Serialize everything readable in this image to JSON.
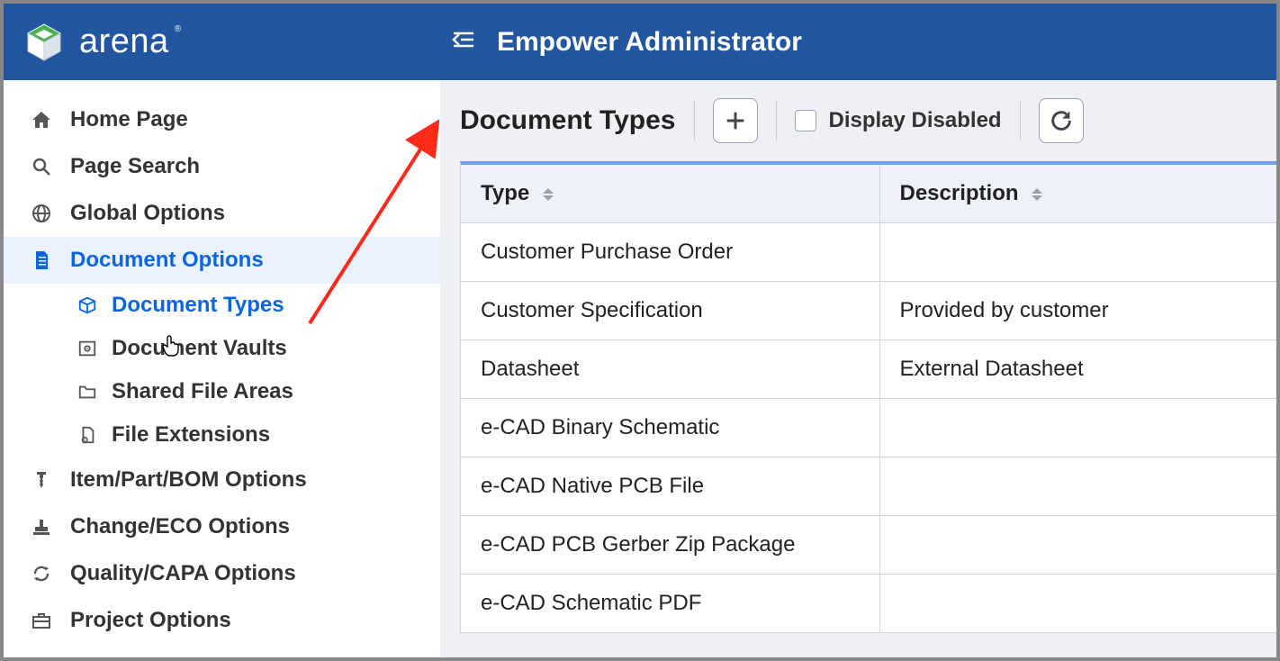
{
  "brand": {
    "name": "arena"
  },
  "header": {
    "app_title": "Empower Administrator"
  },
  "sidebar": {
    "items": [
      {
        "label": "Home Page"
      },
      {
        "label": "Page Search"
      },
      {
        "label": "Global Options"
      },
      {
        "label": "Document Options"
      },
      {
        "label": "Item/Part/BOM Options"
      },
      {
        "label": "Change/ECO Options"
      },
      {
        "label": "Quality/CAPA Options"
      },
      {
        "label": "Project Options"
      }
    ],
    "document_subitems": [
      {
        "label": "Document Types"
      },
      {
        "label": "Document Vaults"
      },
      {
        "label": "Shared File Areas"
      },
      {
        "label": "File Extensions"
      }
    ]
  },
  "main": {
    "title": "Document Types",
    "display_disabled_label": "Display Disabled",
    "columns": {
      "type": "Type",
      "description": "Description"
    },
    "rows": [
      {
        "type": "Customer Purchase Order",
        "description": ""
      },
      {
        "type": "Customer Specification",
        "description": "Provided by customer"
      },
      {
        "type": "Datasheet",
        "description": "External Datasheet"
      },
      {
        "type": "e-CAD Binary Schematic",
        "description": ""
      },
      {
        "type": "e-CAD Native PCB File",
        "description": ""
      },
      {
        "type": "e-CAD PCB Gerber Zip Package",
        "description": ""
      },
      {
        "type": "e-CAD Schematic PDF",
        "description": ""
      }
    ]
  }
}
